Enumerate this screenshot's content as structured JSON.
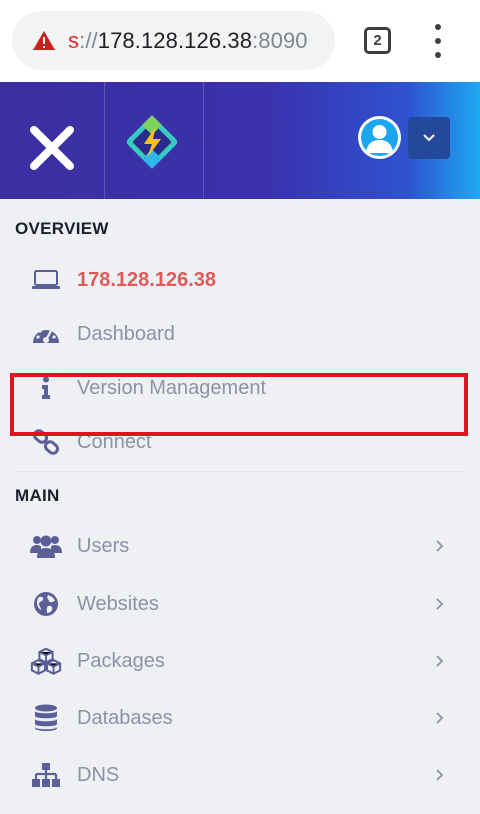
{
  "browser": {
    "url_scheme": "s",
    "url_sep": "://",
    "url_host": "178.128.126.38",
    "url_port": ":8090",
    "tab_count": "2"
  },
  "colors": {
    "header_start": "#3b2fa0",
    "header_end": "#1ea8f4",
    "active_text": "#e05a5a",
    "highlight_border": "#e3131e",
    "icon": "#5b5f97"
  },
  "header": {
    "close_icon": "close-icon",
    "logo_icon": "app-logo",
    "avatar_icon": "user-avatar-icon",
    "dropdown_icon": "chevron-down-icon"
  },
  "sidebar": {
    "overview_title": "OVERVIEW",
    "overview_items": [
      {
        "label": "178.128.126.38",
        "icon": "laptop-icon",
        "active": true
      },
      {
        "label": "Dashboard",
        "icon": "dashboard-gauge-icon"
      },
      {
        "label": "Version Management",
        "icon": "info-icon"
      },
      {
        "label": "Connect",
        "icon": "link-icon"
      }
    ],
    "main_title": "MAIN",
    "main_items": [
      {
        "label": "Users",
        "icon": "users-icon"
      },
      {
        "label": "Websites",
        "icon": "globe-icon",
        "highlighted": true
      },
      {
        "label": "Packages",
        "icon": "cubes-icon"
      },
      {
        "label": "Databases",
        "icon": "database-icon"
      },
      {
        "label": "DNS",
        "icon": "sitemap-icon"
      }
    ]
  }
}
